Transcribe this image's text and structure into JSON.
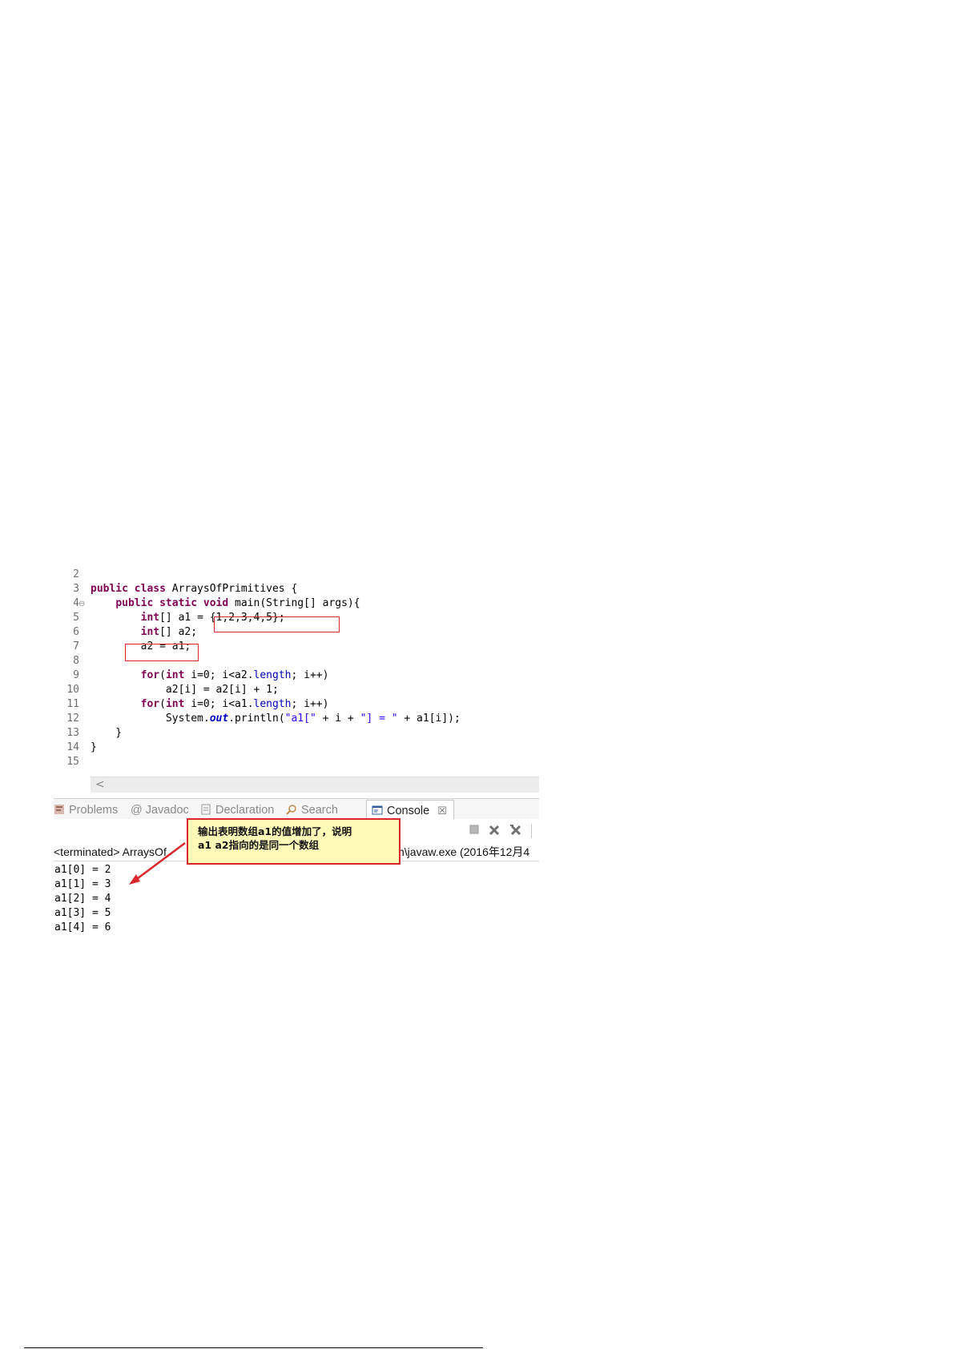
{
  "editor": {
    "lines": [
      {
        "n": "2",
        "segments": []
      },
      {
        "n": "3",
        "segments": [
          {
            "t": "public class ",
            "k": "kw"
          },
          {
            "t": "ArraysOfPrimitives {",
            "k": ""
          }
        ]
      },
      {
        "n": "4",
        "segments": [
          {
            "t": "    ",
            "k": ""
          },
          {
            "t": "public static void ",
            "k": "kw"
          },
          {
            "t": "main(String[] args){",
            "k": ""
          }
        ]
      },
      {
        "n": "5",
        "segments": [
          {
            "t": "        ",
            "k": ""
          },
          {
            "t": "int",
            "k": "kw"
          },
          {
            "t": "[] a1 = {1,2,3,4,5};",
            "k": ""
          }
        ]
      },
      {
        "n": "6",
        "segments": [
          {
            "t": "        ",
            "k": ""
          },
          {
            "t": "int",
            "k": "kw"
          },
          {
            "t": "[] a2;",
            "k": ""
          }
        ]
      },
      {
        "n": "7",
        "segments": [
          {
            "t": "        a2 = a1;",
            "k": ""
          }
        ]
      },
      {
        "n": "8",
        "segments": []
      },
      {
        "n": "9",
        "segments": [
          {
            "t": "        ",
            "k": ""
          },
          {
            "t": "for",
            "k": "kw"
          },
          {
            "t": "(",
            "k": ""
          },
          {
            "t": "int",
            "k": "kw"
          },
          {
            "t": " i=0; i<a2.",
            "k": ""
          },
          {
            "t": "length",
            "k": "fld"
          },
          {
            "t": "; i++)",
            "k": ""
          }
        ]
      },
      {
        "n": "10",
        "segments": [
          {
            "t": "            a2[i] = a2[i] + 1;",
            "k": ""
          }
        ]
      },
      {
        "n": "11",
        "segments": [
          {
            "t": "        ",
            "k": ""
          },
          {
            "t": "for",
            "k": "kw"
          },
          {
            "t": "(",
            "k": ""
          },
          {
            "t": "int",
            "k": "kw"
          },
          {
            "t": " i=0; i<a1.",
            "k": ""
          },
          {
            "t": "length",
            "k": "fld"
          },
          {
            "t": "; i++)",
            "k": ""
          }
        ]
      },
      {
        "n": "12",
        "segments": [
          {
            "t": "            System.",
            "k": ""
          },
          {
            "t": "out",
            "k": "sfld"
          },
          {
            "t": ".println(",
            "k": ""
          },
          {
            "t": "\"a1[\"",
            "k": "str"
          },
          {
            "t": " + i + ",
            "k": ""
          },
          {
            "t": "\"] = \"",
            "k": "str"
          },
          {
            "t": " + a1[i]);",
            "k": ""
          }
        ]
      },
      {
        "n": "13",
        "segments": [
          {
            "t": "    }",
            "k": ""
          }
        ]
      },
      {
        "n": "14",
        "segments": [
          {
            "t": "}",
            "k": ""
          }
        ]
      },
      {
        "n": "15",
        "segments": []
      }
    ],
    "fold_marker": "⊖"
  },
  "tabs": [
    {
      "label": "Problems",
      "icon": "problems-icon"
    },
    {
      "label": "@ Javadoc",
      "icon": "javadoc-icon"
    },
    {
      "label": "Declaration",
      "icon": "declaration-icon"
    },
    {
      "label": "Search",
      "icon": "search-icon"
    },
    {
      "label": "Console",
      "icon": "console-icon",
      "close": "☒"
    }
  ],
  "console": {
    "terminated_prefix": "<terminated> ArraysOf",
    "terminated_suffix": "n\\javaw.exe (2016年12月4",
    "output": [
      "a1[0] = 2",
      "a1[1] = 3",
      "a1[2] = 4",
      "a1[3] = 5",
      "a1[4] = 6"
    ]
  },
  "callout": {
    "line1": "输出表明数组a1的值增加了，说明",
    "line2": "a1 a2指向的是同一个数组"
  },
  "colors": {
    "keyword": "#7f0055",
    "field": "#0000c0",
    "string": "#2a00ff",
    "annotation": "#d9262b",
    "callout_bg": "#fffab8"
  }
}
